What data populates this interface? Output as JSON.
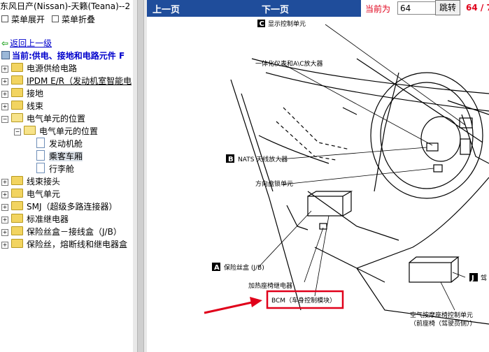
{
  "window_title": "东风日产(Nissan)-天籁(Teana)--2",
  "menu": {
    "expand": "菜单展开",
    "collapse": "菜单折叠"
  },
  "back_link": "返回上一级",
  "current_path": "当前:供电、接地和电路元件 F",
  "tree": [
    {
      "label": "电源供给电路",
      "state": "+"
    },
    {
      "label": "IPDM E/R（发动机室智能电",
      "state": "+"
    },
    {
      "label": "接地",
      "state": "+"
    },
    {
      "label": "线束",
      "state": "+"
    },
    {
      "label": "电气单元的位置",
      "state": "-"
    },
    {
      "label": "电气单元的位置",
      "state": "-"
    },
    {
      "label": "发动机舱",
      "state": "doc"
    },
    {
      "label": "乘客车厢",
      "state": "doc"
    },
    {
      "label": "行李舱",
      "state": "doc"
    },
    {
      "label": "线束接头",
      "state": "+"
    },
    {
      "label": "电气单元",
      "state": "+"
    },
    {
      "label": "SMJ（超级多路连接器）",
      "state": "+"
    },
    {
      "label": "标准继电器",
      "state": "+"
    },
    {
      "label": "保险丝盒－接线盒（J/B）",
      "state": "+"
    },
    {
      "label": "保险丝，熔断线和继电器盒",
      "state": "+"
    }
  ],
  "nav": {
    "prev": "上一页",
    "next": "下一页",
    "current_label": "当前为",
    "page_value": "64",
    "go_button": "跳转",
    "page_count": "64 / 7"
  },
  "diagram": {
    "labels": {
      "c_letter": "C",
      "c_text": "显示控制单元",
      "amp_text": "一体化仪表和A\\C放大器",
      "b_letter": "B",
      "b_text": "NATS 天线放大器",
      "steer_text": "方向盘锁单元",
      "a_letter": "A",
      "a_text": "保险丝盒 (J/B)",
      "heat_text": "加热座椅继电器",
      "bcm_text": "BCM（车身控制模块）",
      "j_letter": "J",
      "j_text": "驾",
      "seat_text1": "空气按摩座椅控制单元",
      "seat_text2": "（前座椅（驾驶员侧））"
    },
    "colors": {
      "highlight": "#e0001a",
      "navbar": "#1f4d9b"
    }
  }
}
